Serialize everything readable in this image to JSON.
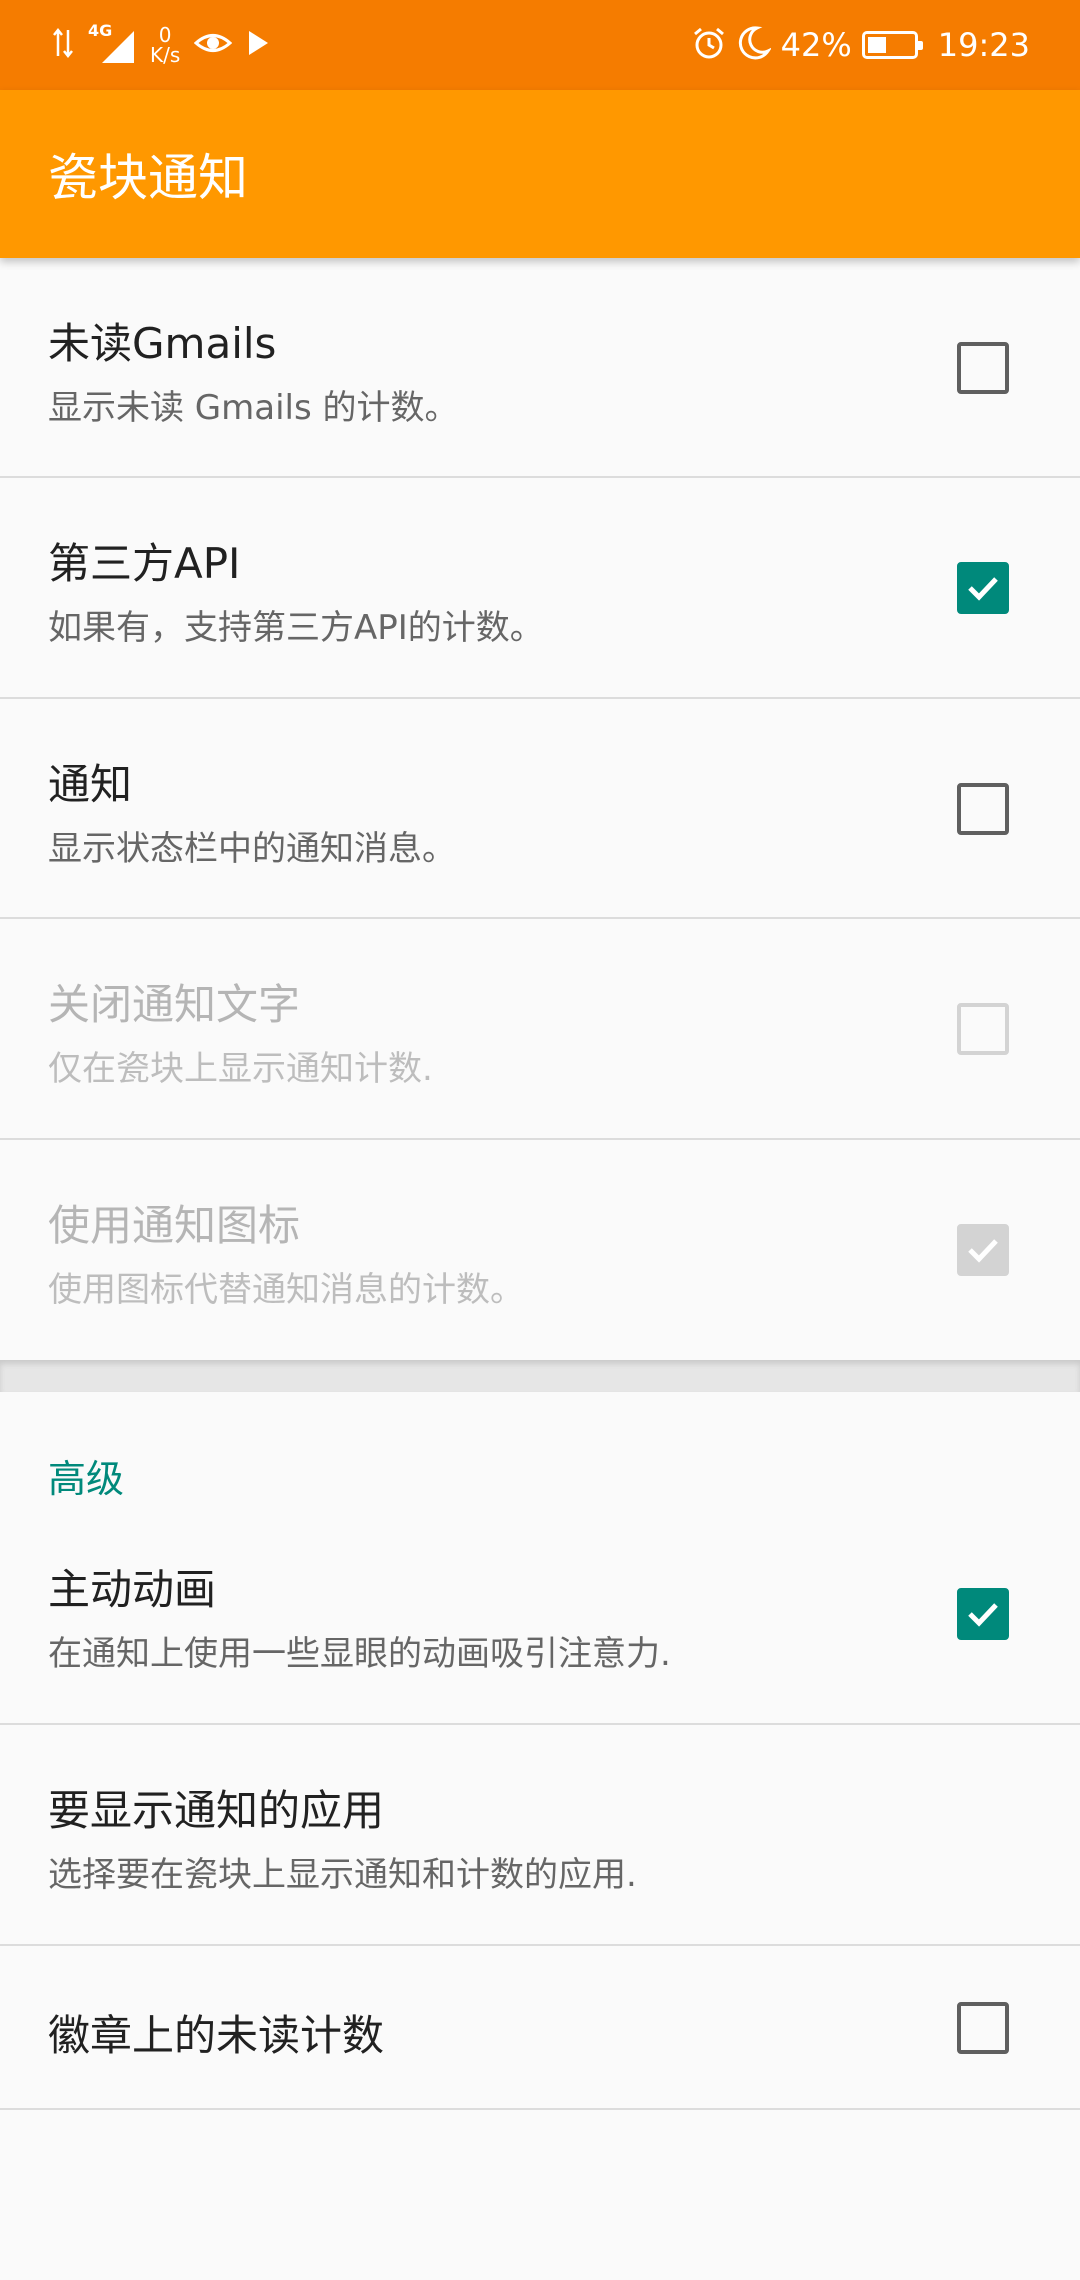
{
  "status_bar": {
    "network": "4G",
    "speed_value": "0",
    "speed_unit": "K/s",
    "battery": "42%",
    "battery_level": 0.42,
    "time": "19:23"
  },
  "app_bar": {
    "title": "瓷块通知"
  },
  "settings": [
    {
      "title": "未读Gmails",
      "subtitle": "显示未读 Gmails 的计数。",
      "checked": false,
      "enabled": true
    },
    {
      "title": "第三方API",
      "subtitle": "如果有，支持第三方API的计数。",
      "checked": true,
      "enabled": true
    },
    {
      "title": "通知",
      "subtitle": "显示状态栏中的通知消息。",
      "checked": false,
      "enabled": true
    },
    {
      "title": "关闭通知文字",
      "subtitle": "仅在瓷块上显示通知计数.",
      "checked": false,
      "enabled": false
    },
    {
      "title": "使用通知图标",
      "subtitle": "使用图标代替通知消息的计数。",
      "checked": true,
      "enabled": false
    }
  ],
  "advanced": {
    "header": "高级",
    "items": [
      {
        "title": "主动动画",
        "subtitle": "在通知上使用一些显眼的动画吸引注意力.",
        "checked": true,
        "enabled": true
      },
      {
        "title": "要显示通知的应用",
        "subtitle": "选择要在瓷块上显示通知和计数的应用."
      },
      {
        "title": "徽章上的未读计数",
        "checked": false,
        "enabled": true
      }
    ]
  },
  "colors": {
    "status_bar": "#f57c00",
    "app_bar": "#ff9800",
    "accent": "#00897b"
  }
}
